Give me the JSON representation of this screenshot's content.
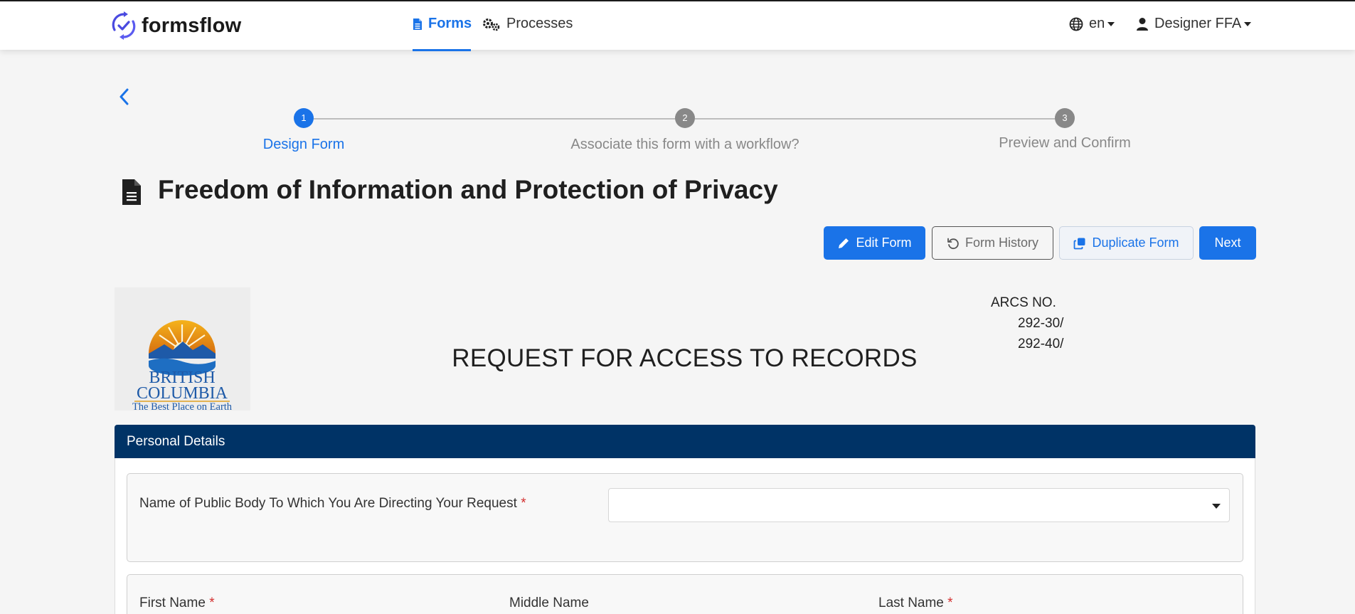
{
  "brand": {
    "name": "formsflow"
  },
  "nav": {
    "forms_label": "Forms",
    "processes_label": "Processes",
    "language_label": "en",
    "user_label": "Designer FFA"
  },
  "stepper": {
    "steps": [
      {
        "number": "1",
        "label": "Design Form",
        "active": true
      },
      {
        "number": "2",
        "label": "Associate this form with a workflow?",
        "active": false
      },
      {
        "number": "3",
        "label": "Preview and Confirm",
        "active": false
      }
    ]
  },
  "page": {
    "title": "Freedom of Information and Protection of Privacy"
  },
  "actions": {
    "edit_label": "Edit Form",
    "history_label": "Form History",
    "duplicate_label": "Duplicate Form",
    "next_label": "Next"
  },
  "form": {
    "logo": {
      "line1": "BRITISH",
      "line2": "COLUMBIA",
      "tagline": "The Best Place on Earth"
    },
    "arcs": {
      "label": "ARCS NO.",
      "numbers": [
        "292-30/",
        "292-40/"
      ]
    },
    "title": "REQUEST FOR ACCESS TO RECORDS",
    "section": {
      "title": "Personal Details",
      "public_body_label": "Name of Public Body To Which You Are Directing Your Request",
      "public_body_value": "",
      "first_name_label": "First Name",
      "middle_name_label": "Middle Name",
      "last_name_label": "Last Name",
      "required_marker": "*"
    }
  },
  "colors": {
    "accent": "#1a73e8",
    "section_header": "#003366",
    "required": "#d32f2f"
  }
}
